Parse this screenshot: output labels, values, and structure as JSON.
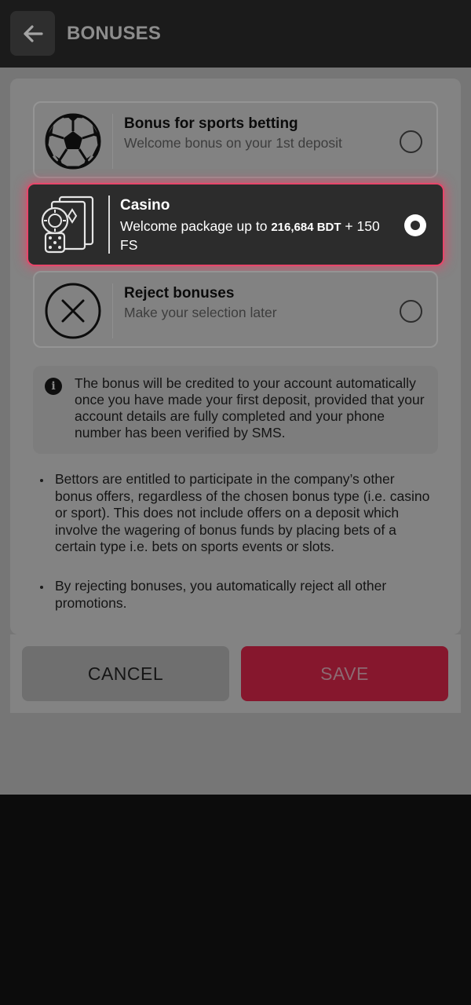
{
  "header": {
    "title": "BONUSES",
    "back_icon": "arrow-left-icon"
  },
  "options": [
    {
      "id": "sports",
      "title": "Bonus for sports betting",
      "subtitle": "Welcome bonus on your 1st deposit",
      "icon": "soccer-ball-icon",
      "selected": false
    },
    {
      "id": "casino",
      "title": "Casino",
      "subtitle_prefix": "Welcome package up to",
      "amount": "216,684 BDT",
      "subtitle_suffix": "+ 150 FS",
      "icon": "casino-cards-dice-icon",
      "selected": true
    },
    {
      "id": "reject",
      "title": "Reject bonuses",
      "subtitle": "Make your selection later",
      "icon": "close-circle-icon",
      "selected": false
    }
  ],
  "info": {
    "icon": "info-icon",
    "text": "The bonus will be credited to your account automatically once you have made your first deposit, provided that your account details are fully completed and your phone number has been verified by SMS."
  },
  "bullets": [
    "Bettors are entitled to participate in the company’s other bonus offers, regardless of the chosen bonus type (i.e. casino or sport). This does not include offers on a deposit which involve the wagering of bonus funds by placing bets of a certain type i.e. bets on sports events or slots.",
    "By rejecting bonuses, you automatically reject all other promotions."
  ],
  "actions": {
    "cancel_label": "CANCEL",
    "save_label": "SAVE"
  },
  "colors": {
    "accent": "#e8466a",
    "save_button": "#86172d",
    "selected_card": "#2c2c2c"
  }
}
